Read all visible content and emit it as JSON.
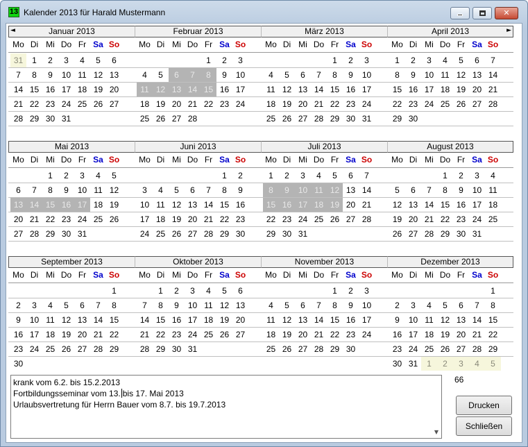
{
  "window": {
    "title": "Kalender 2013 für Harald Mustermann",
    "app_icon": "13",
    "minimize_icon": "minimize-icon",
    "maximize_icon": "maximize-icon",
    "close_icon": "close-icon"
  },
  "nav": {
    "prev": "◄",
    "next": "►"
  },
  "weekdays": [
    "Mo",
    "Di",
    "Mi",
    "Do",
    "Fr",
    "Sa",
    "So"
  ],
  "months": [
    {
      "name": "Januar 2013",
      "weeks": [
        [
          "31",
          "1",
          "2",
          "3",
          "4",
          "5",
          "6"
        ],
        [
          "7",
          "8",
          "9",
          "10",
          "11",
          "12",
          "13"
        ],
        [
          "14",
          "15",
          "16",
          "17",
          "18",
          "19",
          "20"
        ],
        [
          "21",
          "22",
          "23",
          "24",
          "25",
          "26",
          "27"
        ],
        [
          "28",
          "29",
          "30",
          "31",
          "",
          "",
          ""
        ]
      ],
      "other": [
        [
          0,
          0
        ]
      ],
      "highlight": []
    },
    {
      "name": "Februar 2013",
      "weeks": [
        [
          "",
          "",
          "",
          "",
          "1",
          "2",
          "3"
        ],
        [
          "4",
          "5",
          "6",
          "7",
          "8",
          "9",
          "10"
        ],
        [
          "11",
          "12",
          "13",
          "14",
          "15",
          "16",
          "17"
        ],
        [
          "18",
          "19",
          "20",
          "21",
          "22",
          "23",
          "24"
        ],
        [
          "25",
          "26",
          "27",
          "28",
          "",
          "",
          ""
        ]
      ],
      "other": [],
      "highlight": [
        [
          1,
          2
        ],
        [
          1,
          3
        ],
        [
          1,
          4
        ],
        [
          2,
          0
        ],
        [
          2,
          1
        ],
        [
          2,
          2
        ],
        [
          2,
          3
        ],
        [
          2,
          4
        ]
      ]
    },
    {
      "name": "März 2013",
      "weeks": [
        [
          "",
          "",
          "",
          "",
          "1",
          "2",
          "3"
        ],
        [
          "4",
          "5",
          "6",
          "7",
          "8",
          "9",
          "10"
        ],
        [
          "11",
          "12",
          "13",
          "14",
          "15",
          "16",
          "17"
        ],
        [
          "18",
          "19",
          "20",
          "21",
          "22",
          "23",
          "24"
        ],
        [
          "25",
          "26",
          "27",
          "28",
          "29",
          "30",
          "31"
        ]
      ],
      "other": [],
      "highlight": []
    },
    {
      "name": "April 2013",
      "weeks": [
        [
          "1",
          "2",
          "3",
          "4",
          "5",
          "6",
          "7"
        ],
        [
          "8",
          "9",
          "10",
          "11",
          "12",
          "13",
          "14"
        ],
        [
          "15",
          "16",
          "17",
          "18",
          "19",
          "20",
          "21"
        ],
        [
          "22",
          "23",
          "24",
          "25",
          "26",
          "27",
          "28"
        ],
        [
          "29",
          "30",
          "",
          "",
          "",
          "",
          ""
        ]
      ],
      "other": [],
      "highlight": []
    },
    {
      "name": "Mai 2013",
      "weeks": [
        [
          "",
          "",
          "1",
          "2",
          "3",
          "4",
          "5"
        ],
        [
          "6",
          "7",
          "8",
          "9",
          "10",
          "11",
          "12"
        ],
        [
          "13",
          "14",
          "15",
          "16",
          "17",
          "18",
          "19"
        ],
        [
          "20",
          "21",
          "22",
          "23",
          "24",
          "25",
          "26"
        ],
        [
          "27",
          "28",
          "29",
          "30",
          "31",
          "",
          ""
        ]
      ],
      "other": [],
      "highlight": [
        [
          2,
          0
        ],
        [
          2,
          1
        ],
        [
          2,
          2
        ],
        [
          2,
          3
        ],
        [
          2,
          4
        ]
      ]
    },
    {
      "name": "Juni 2013",
      "weeks": [
        [
          "",
          "",
          "",
          "",
          "",
          "1",
          "2"
        ],
        [
          "3",
          "4",
          "5",
          "6",
          "7",
          "8",
          "9"
        ],
        [
          "10",
          "11",
          "12",
          "13",
          "14",
          "15",
          "16"
        ],
        [
          "17",
          "18",
          "19",
          "20",
          "21",
          "22",
          "23"
        ],
        [
          "24",
          "25",
          "26",
          "27",
          "28",
          "29",
          "30"
        ]
      ],
      "other": [],
      "highlight": []
    },
    {
      "name": "Juli 2013",
      "weeks": [
        [
          "1",
          "2",
          "3",
          "4",
          "5",
          "6",
          "7"
        ],
        [
          "8",
          "9",
          "10",
          "11",
          "12",
          "13",
          "14"
        ],
        [
          "15",
          "16",
          "17",
          "18",
          "19",
          "20",
          "21"
        ],
        [
          "22",
          "23",
          "24",
          "25",
          "26",
          "27",
          "28"
        ],
        [
          "29",
          "30",
          "31",
          "",
          "",
          "",
          ""
        ]
      ],
      "other": [],
      "highlight": [
        [
          1,
          0
        ],
        [
          1,
          1
        ],
        [
          1,
          2
        ],
        [
          1,
          3
        ],
        [
          1,
          4
        ],
        [
          2,
          0
        ],
        [
          2,
          1
        ],
        [
          2,
          2
        ],
        [
          2,
          3
        ],
        [
          2,
          4
        ]
      ]
    },
    {
      "name": "August 2013",
      "weeks": [
        [
          "",
          "",
          "",
          "1",
          "2",
          "3",
          "4"
        ],
        [
          "5",
          "6",
          "7",
          "8",
          "9",
          "10",
          "11"
        ],
        [
          "12",
          "13",
          "14",
          "15",
          "16",
          "17",
          "18"
        ],
        [
          "19",
          "20",
          "21",
          "22",
          "23",
          "24",
          "25"
        ],
        [
          "26",
          "27",
          "28",
          "29",
          "30",
          "31",
          ""
        ]
      ],
      "other": [],
      "highlight": []
    },
    {
      "name": "September 2013",
      "weeks": [
        [
          "",
          "",
          "",
          "",
          "",
          "",
          "1"
        ],
        [
          "2",
          "3",
          "4",
          "5",
          "6",
          "7",
          "8"
        ],
        [
          "9",
          "10",
          "11",
          "12",
          "13",
          "14",
          "15"
        ],
        [
          "16",
          "17",
          "18",
          "19",
          "20",
          "21",
          "22"
        ],
        [
          "23",
          "24",
          "25",
          "26",
          "27",
          "28",
          "29"
        ],
        [
          "30",
          "",
          "",
          "",
          "",
          "",
          ""
        ]
      ],
      "other": [],
      "highlight": []
    },
    {
      "name": "Oktober 2013",
      "weeks": [
        [
          "",
          "1",
          "2",
          "3",
          "4",
          "5",
          "6"
        ],
        [
          "7",
          "8",
          "9",
          "10",
          "11",
          "12",
          "13"
        ],
        [
          "14",
          "15",
          "16",
          "17",
          "18",
          "19",
          "20"
        ],
        [
          "21",
          "22",
          "23",
          "24",
          "25",
          "26",
          "27"
        ],
        [
          "28",
          "29",
          "30",
          "31",
          "",
          "",
          ""
        ]
      ],
      "other": [],
      "highlight": []
    },
    {
      "name": "November 2013",
      "weeks": [
        [
          "",
          "",
          "",
          "",
          "1",
          "2",
          "3"
        ],
        [
          "4",
          "5",
          "6",
          "7",
          "8",
          "9",
          "10"
        ],
        [
          "11",
          "12",
          "13",
          "14",
          "15",
          "16",
          "17"
        ],
        [
          "18",
          "19",
          "20",
          "21",
          "22",
          "23",
          "24"
        ],
        [
          "25",
          "26",
          "27",
          "28",
          "29",
          "30",
          ""
        ]
      ],
      "other": [],
      "highlight": []
    },
    {
      "name": "Dezember 2013",
      "weeks": [
        [
          "",
          "",
          "",
          "",
          "",
          "",
          "1"
        ],
        [
          "2",
          "3",
          "4",
          "5",
          "6",
          "7",
          "8"
        ],
        [
          "9",
          "10",
          "11",
          "12",
          "13",
          "14",
          "15"
        ],
        [
          "16",
          "17",
          "18",
          "19",
          "20",
          "21",
          "22"
        ],
        [
          "23",
          "24",
          "25",
          "26",
          "27",
          "28",
          "29"
        ],
        [
          "30",
          "31",
          "1",
          "2",
          "3",
          "4",
          "5"
        ]
      ],
      "other": [
        [
          5,
          2
        ],
        [
          5,
          3
        ],
        [
          5,
          4
        ],
        [
          5,
          5
        ],
        [
          5,
          6
        ]
      ],
      "highlight": []
    }
  ],
  "notes": {
    "line1": "krank vom 6.2. bis 15.2.2013",
    "line2_before": "Fortbildungsseminar vom 13.",
    "line2_after": "bis 17. Mai 2013",
    "line3": "Urlaubsvertretung für Herrn Bauer vom 8.7. bis 19.7.2013"
  },
  "counter": "66",
  "buttons": {
    "print": "Drucken",
    "close": "Schließen"
  }
}
